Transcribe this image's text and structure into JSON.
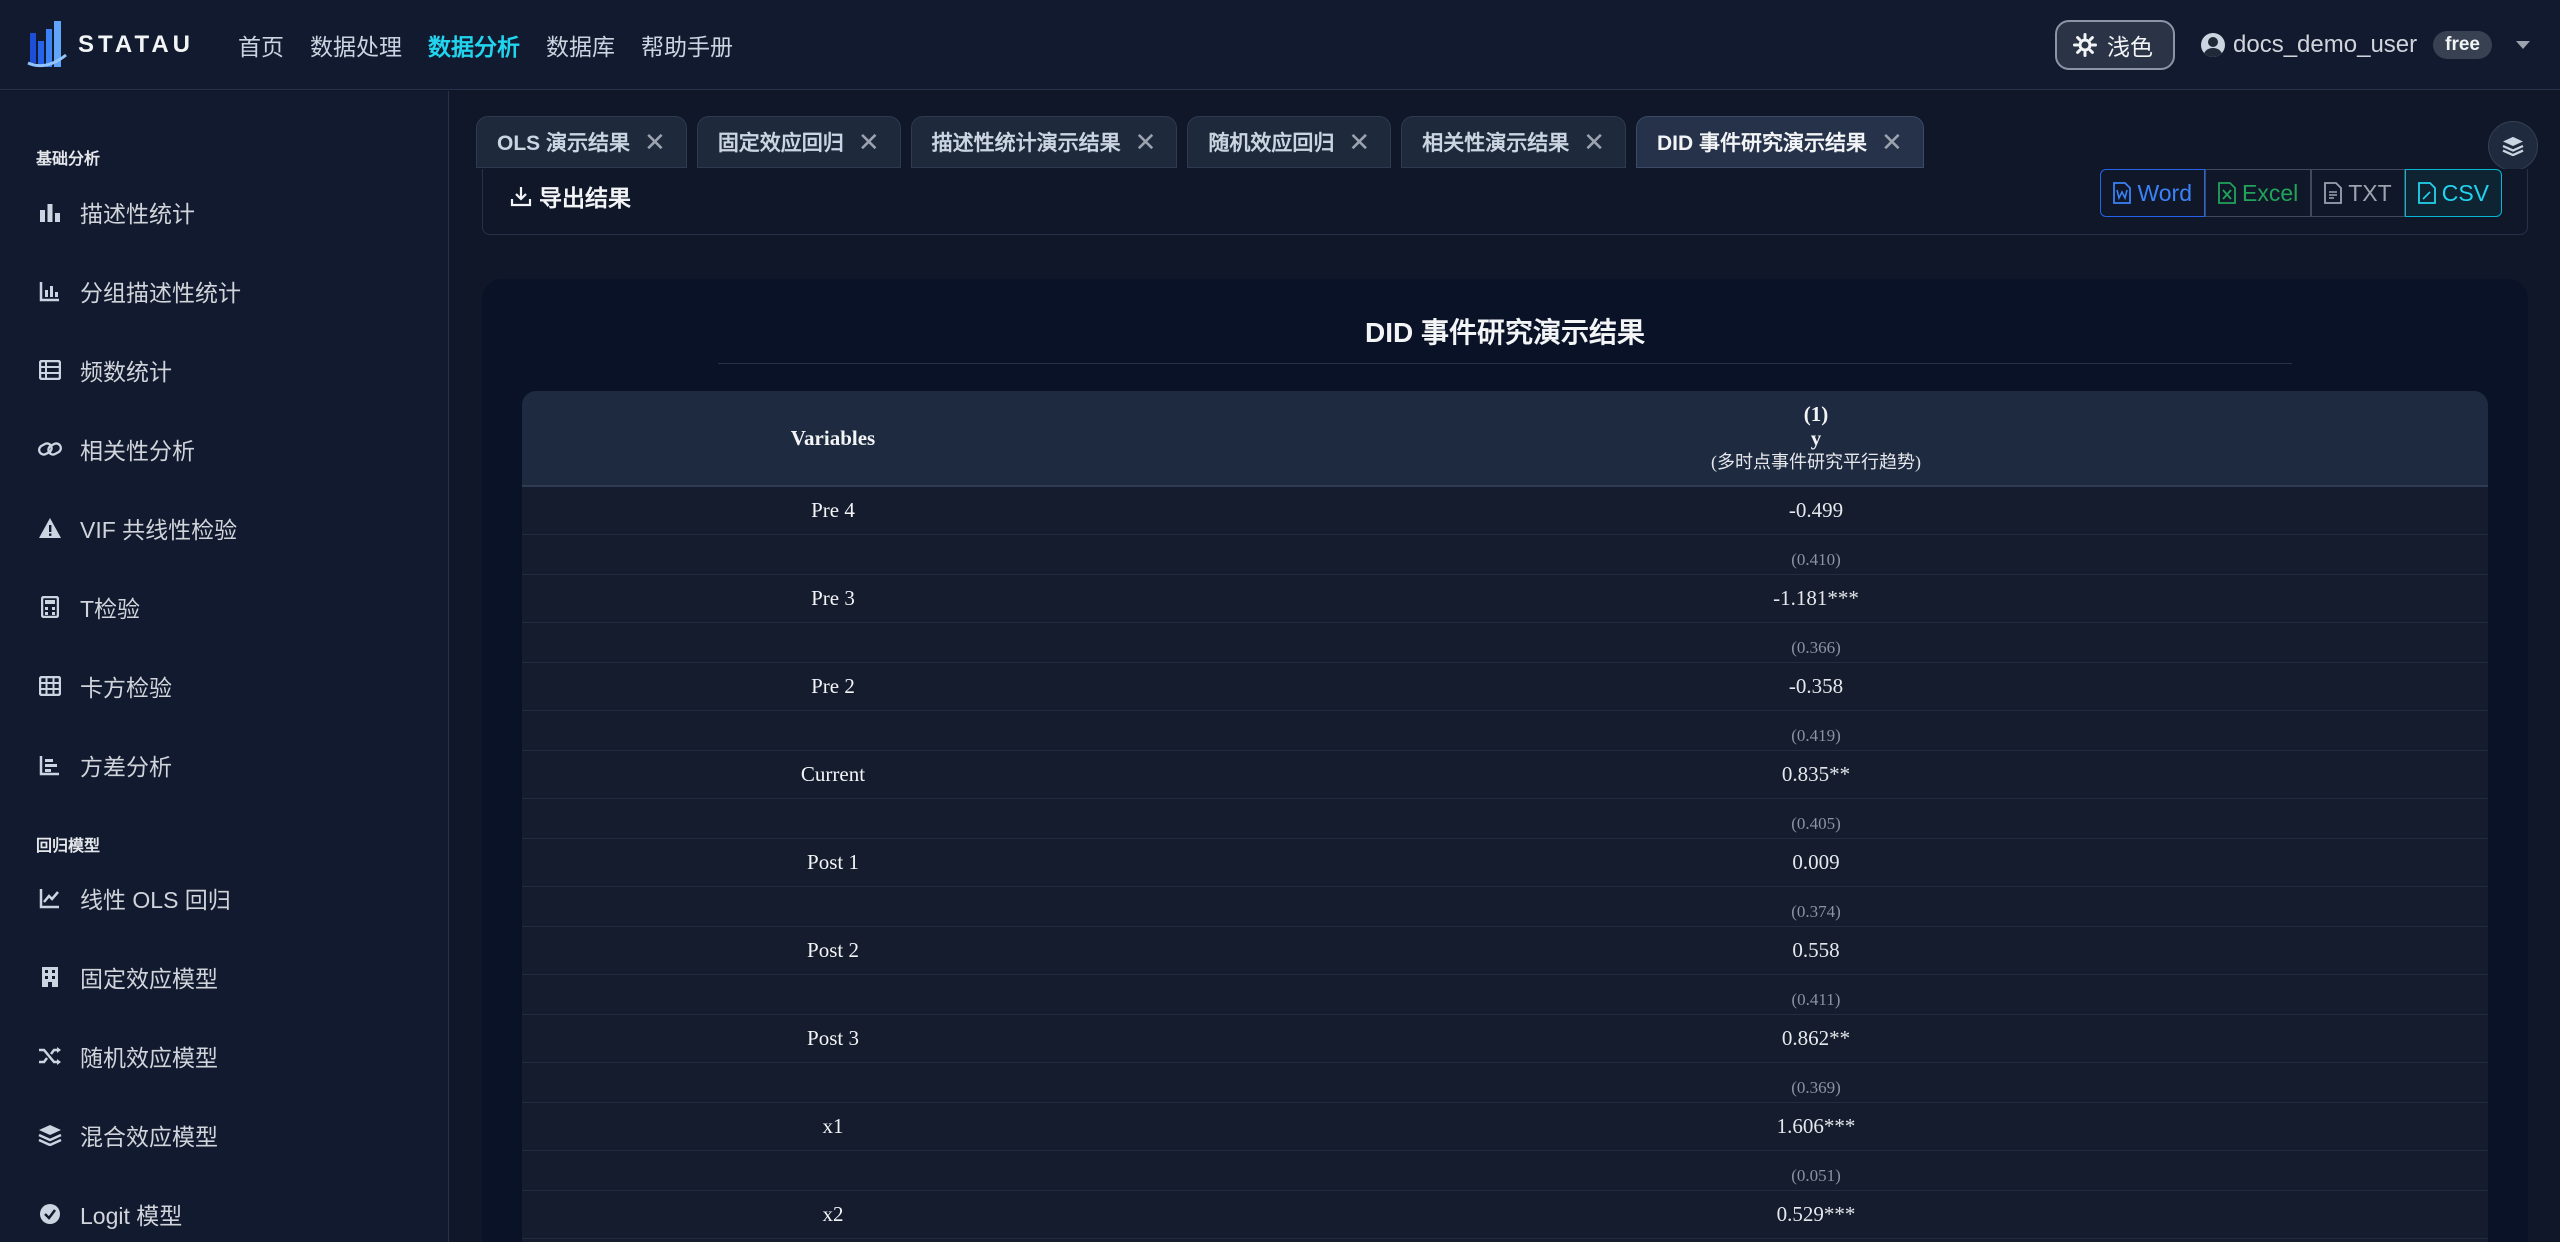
{
  "app": {
    "logo_text": "STATAU",
    "nav": [
      "首页",
      "数据处理",
      "数据分析",
      "数据库",
      "帮助手册"
    ],
    "nav_active": 2,
    "theme_label": "浅色",
    "user_name": "docs_demo_user",
    "plan": "free"
  },
  "sidebar": {
    "sections": [
      {
        "title": "基础分析",
        "items": [
          {
            "label": "描述性统计",
            "icon": "bar-chart-icon"
          },
          {
            "label": "分组描述性统计",
            "icon": "grouped-chart-icon"
          },
          {
            "label": "频数统计",
            "icon": "table-list-icon"
          },
          {
            "label": "相关性分析",
            "icon": "link-icon"
          },
          {
            "label": "VIF 共线性检验",
            "icon": "warning-icon"
          },
          {
            "label": "T检验",
            "icon": "calculator-icon"
          },
          {
            "label": "卡方检验",
            "icon": "grid-icon"
          },
          {
            "label": "方差分析",
            "icon": "bar-chart-horizontal-icon"
          }
        ]
      },
      {
        "title": "回归模型",
        "items": [
          {
            "label": "线性 OLS 回归",
            "icon": "line-chart-icon"
          },
          {
            "label": "固定效应模型",
            "icon": "building-icon"
          },
          {
            "label": "随机效应模型",
            "icon": "shuffle-icon"
          },
          {
            "label": "混合效应模型",
            "icon": "layers-icon"
          },
          {
            "label": "Logit 模型",
            "icon": "check-circle-icon"
          }
        ]
      }
    ]
  },
  "tabs": [
    {
      "label": "OLS 演示结果"
    },
    {
      "label": "固定效应回归"
    },
    {
      "label": "描述性统计演示结果"
    },
    {
      "label": "随机效应回归"
    },
    {
      "label": "相关性演示结果"
    },
    {
      "label": "DID 事件研究演示结果"
    }
  ],
  "active_tab": 5,
  "export": {
    "title": "导出结果",
    "buttons": {
      "word": "Word",
      "excel": "Excel",
      "txt": "TXT",
      "csv": "CSV"
    }
  },
  "result": {
    "title": "DID 事件研究演示结果",
    "header": {
      "var_col": "Variables",
      "model_num": "(1)",
      "dep_var": "y",
      "model_note": "(多时点事件研究平行趋势)"
    },
    "rows": [
      {
        "var": "Pre 4",
        "coef": "-0.499",
        "se": "(0.410)"
      },
      {
        "var": "Pre 3",
        "coef": "-1.181***",
        "se": "(0.366)"
      },
      {
        "var": "Pre 2",
        "coef": "-0.358",
        "se": "(0.419)"
      },
      {
        "var": "Current",
        "coef": "0.835**",
        "se": "(0.405)"
      },
      {
        "var": "Post 1",
        "coef": "0.009",
        "se": "(0.374)"
      },
      {
        "var": "Post 2",
        "coef": "0.558",
        "se": "(0.411)"
      },
      {
        "var": "Post 3",
        "coef": "0.862**",
        "se": "(0.369)"
      },
      {
        "var": "x1",
        "coef": "1.606***",
        "se": "(0.051)"
      },
      {
        "var": "x2",
        "coef": "0.529***",
        "se": ""
      }
    ]
  }
}
